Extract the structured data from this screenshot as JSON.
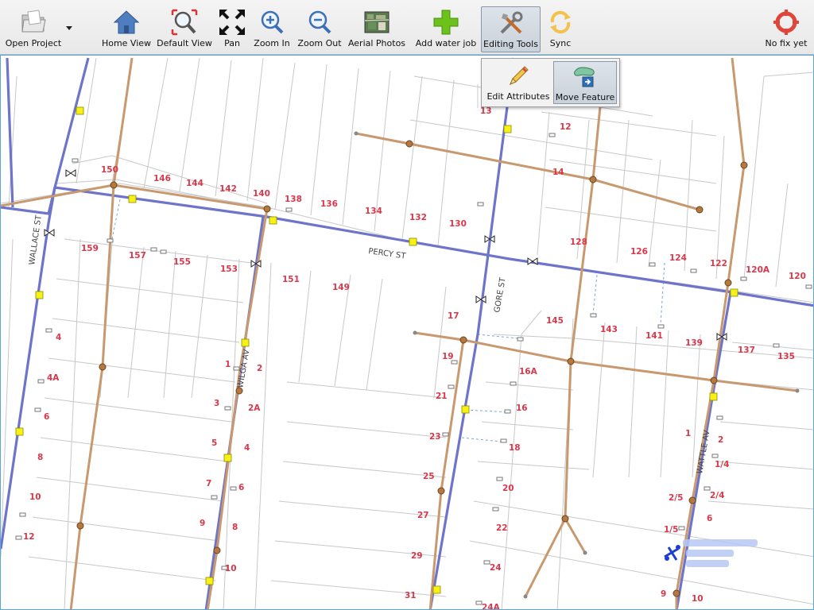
{
  "toolbar": {
    "open_project": "Open Project",
    "home_view": "Home View",
    "default_view": "Default View",
    "pan": "Pan",
    "zoom_in": "Zoom In",
    "zoom_out": "Zoom Out",
    "aerial_photos": "Aerial Photos",
    "add_water_job": "Add water job",
    "editing_tools": "Editing Tools",
    "sync": "Sync",
    "gps_status": "No fix yet"
  },
  "editing_menu": {
    "edit_attributes": "Edit Attributes",
    "move_feature": "Move Feature"
  },
  "map": {
    "streets": [
      "WALLACE ST",
      "PERCY ST",
      "WILGA AV",
      "GORE ST",
      "WATTLE AV"
    ],
    "lot_numbers": [
      "150",
      "146",
      "144",
      "142",
      "140",
      "138",
      "136",
      "134",
      "132",
      "130",
      "13",
      "12",
      "14",
      "159",
      "157",
      "155",
      "153",
      "151",
      "149",
      "128",
      "126",
      "124",
      "122",
      "120A",
      "120",
      "17",
      "145",
      "143",
      "141",
      "139",
      "137",
      "135",
      "4",
      "4A",
      "6",
      "8",
      "10",
      "12",
      "1",
      "2",
      "3",
      "2A",
      "5",
      "4",
      "7",
      "6",
      "9",
      "8",
      "10",
      "19",
      "21",
      "23",
      "25",
      "27",
      "29",
      "31",
      "16A",
      "16",
      "18",
      "20",
      "22",
      "24",
      "24A",
      "1",
      "2",
      "1/4",
      "2/5",
      "2/4",
      "1/5",
      "6",
      "9",
      "10"
    ]
  },
  "colors": {
    "water_main": "#6d74c9",
    "sewer_line": "#c8996e",
    "lot_label": "#d9384b",
    "property_line": "#c8c8c8",
    "accent_selected": "#c9d1da"
  }
}
